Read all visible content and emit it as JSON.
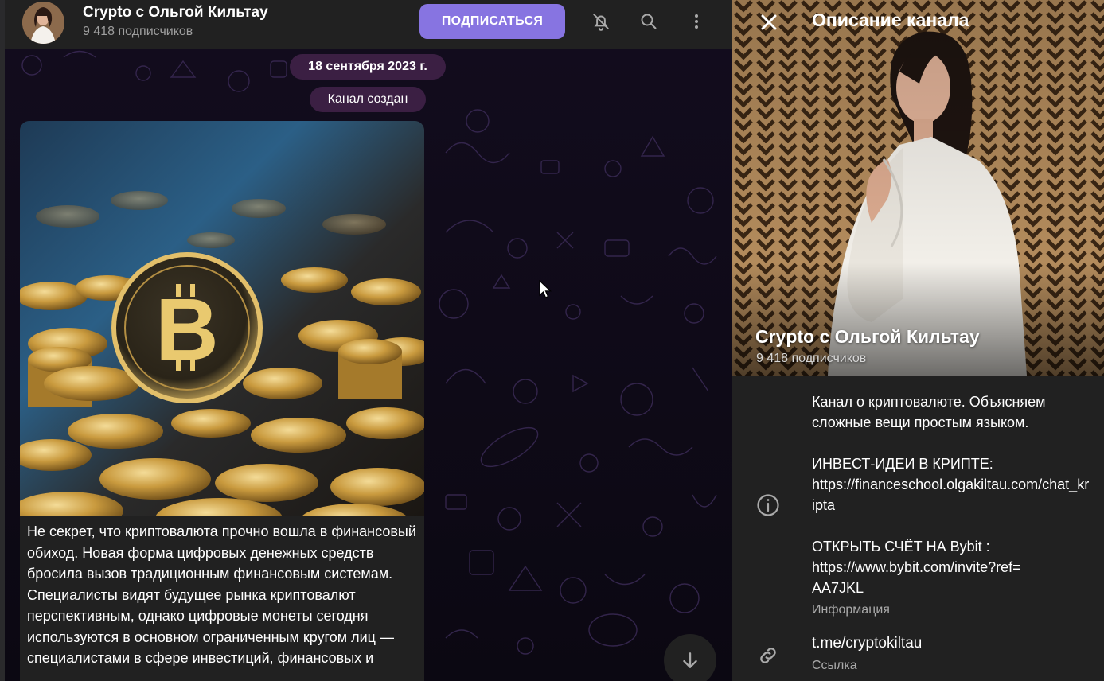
{
  "chat": {
    "channel_title": "Crypto с Ольгой Кильтау",
    "subscribers": "9 418 подписчиков",
    "subscribe_button": "ПОДПИСАТЬСЯ",
    "header_icons": [
      "mute-icon",
      "search-icon",
      "more-vert-icon"
    ],
    "date_pill": "18 сентября 2023 г.",
    "service_message": "Канал создан",
    "message_text": "Не секрет, что криптовалюта прочно вошла в финансовый обиход. Новая форма цифровых денежных средств бросила вызов традиционным финансовым системам. Специалисты видят будущее рынка криптовалют перспективным, однако цифровые монеты сегодня используются в основном ограниченным кругом лиц — специалистами в сфере инвестиций, финансовых и",
    "colors": {
      "accent": "#8774e1",
      "pill": "#3b1f43",
      "bubble": "#212121"
    }
  },
  "panel": {
    "title": "Описание канала",
    "channel_name": "Crypto с Ольгой Кильтау",
    "subscribers": "9 418 подписчиков",
    "description_lines": [
      "Канал о криптовалюте. Объясняем сложные вещи простым языком.",
      "",
      "ИНВЕСТ-ИДЕИ В КРИПТЕ:",
      "https://financeschool.olgakiltau.com/chat_kripta",
      "",
      "ОТКРЫТЬ СЧЁТ НА Bybit :",
      "https://www.bybit.com/invite?ref=AA7JKL"
    ],
    "description_caption": "Информация",
    "link": "t.me/cryptokiltau",
    "link_caption": "Ссылка"
  }
}
